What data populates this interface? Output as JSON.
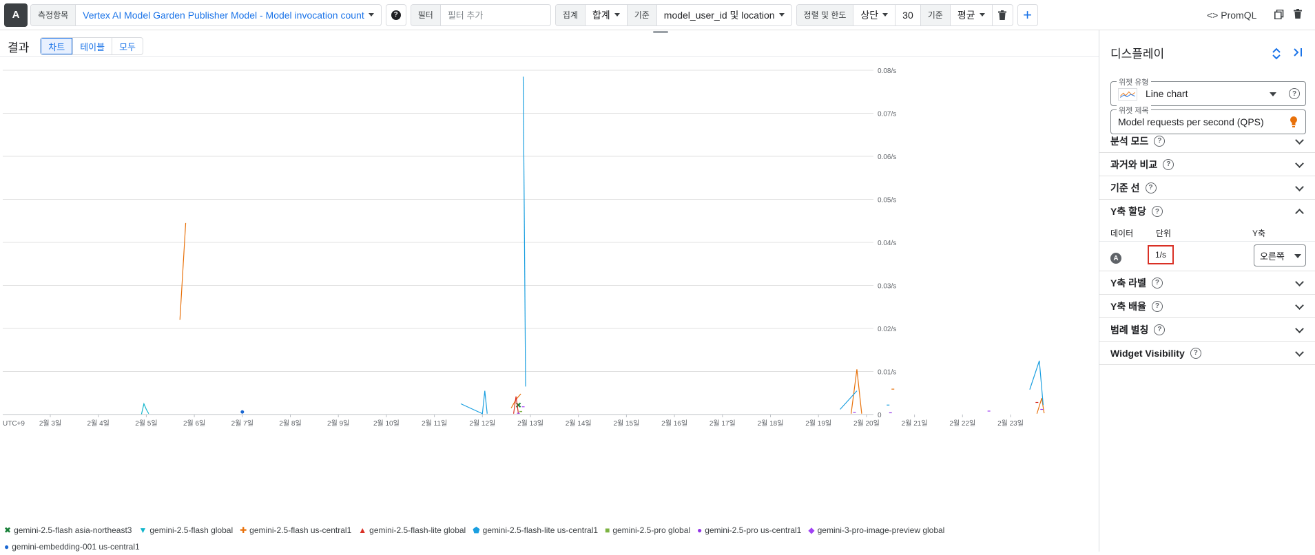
{
  "toolbar": {
    "badge": "A",
    "metric_label": "측정항목",
    "metric_value": "Vertex AI Model Garden Publisher Model - Model invocation count",
    "filter_label": "필터",
    "filter_placeholder": "필터 추가",
    "aggregate_label": "집계",
    "aggregate_value": "합계",
    "by_label": "기준",
    "by_value": "model_user_id 및 location",
    "sort_label": "정렬 및 한도",
    "sort_value": "상단",
    "limit_value": "30",
    "sort_by_label": "기준",
    "sort_by_value": "평균",
    "promql": "<> PromQL"
  },
  "results": {
    "title": "결과",
    "tabs": [
      "차트",
      "테이블",
      "모두"
    ],
    "active_tab": "차트"
  },
  "chart_data": {
    "type": "line",
    "title": "",
    "timezone_label": "UTC+9",
    "x_ticks": [
      "2월 3일",
      "2월 4일",
      "2월 5일",
      "2월 6일",
      "2월 7일",
      "2월 8일",
      "2월 9일",
      "2월 10일",
      "2월 11일",
      "2월 12일",
      "2월 13일",
      "2월 14일",
      "2월 15일",
      "2월 16일",
      "2월 17일",
      "2월 18일",
      "2월 19일",
      "2월 20일",
      "2월 21일",
      "2월 22일",
      "2월 23일"
    ],
    "y_ticks": [
      "0",
      "0.01/s",
      "0.02/s",
      "0.03/s",
      "0.04/s",
      "0.05/s",
      "0.06/s",
      "0.07/s",
      "0.08/s"
    ],
    "ylim": [
      0,
      0.08
    ],
    "xlim": [
      2.25,
      23.7
    ],
    "y_axis_side": "right",
    "grid": true,
    "series": [
      {
        "name": "gemini-2.5-flash asia-northeast3",
        "color": "#188038",
        "marker": "cross",
        "points": [
          [
            12.75,
            0.0022
          ]
        ]
      },
      {
        "name": "gemini-2.5-flash global",
        "color": "#12b5cb",
        "marker": "triangle-down",
        "points": [
          [
            4.9,
            0.0001
          ],
          [
            4.95,
            0.0025
          ],
          [
            5.0,
            0.0012
          ],
          [
            5.05,
            0.0002
          ]
        ]
      },
      {
        "name": "gemini-2.5-flash us-central1",
        "color": "#e8710a",
        "marker": "plus",
        "points": [
          [
            5.7,
            0.022
          ],
          [
            5.82,
            0.0445
          ],
          [
            12.6,
            0.0015
          ],
          [
            12.7,
            0.0035
          ],
          [
            12.8,
            0.0048
          ],
          [
            19.68,
            0.0002
          ],
          [
            19.8,
            0.0105
          ],
          [
            19.9,
            0.0002
          ],
          [
            20.55,
            0.0059
          ],
          [
            23.55,
            0.0002
          ],
          [
            23.65,
            0.0038
          ],
          [
            23.7,
            0.0003
          ]
        ]
      },
      {
        "name": "gemini-2.5-flash-lite global",
        "color": "#d93025",
        "marker": "triangle-up",
        "points": [
          [
            12.65,
            0.0002
          ],
          [
            12.7,
            0.0042
          ],
          [
            12.75,
            0.0002
          ],
          [
            23.55,
            0.0028
          ]
        ]
      },
      {
        "name": "gemini-2.5-flash-lite us-central1",
        "color": "#1a9fe0",
        "marker": "shield",
        "points": [
          [
            11.55,
            0.0025
          ],
          [
            12.0,
            0.0002
          ],
          [
            12.05,
            0.0055
          ],
          [
            12.1,
            0.0002
          ],
          [
            12.85,
            0.0785
          ],
          [
            12.9,
            0.0065
          ],
          [
            19.45,
            0.0012
          ],
          [
            19.8,
            0.0055
          ],
          [
            20.45,
            0.0022
          ],
          [
            23.4,
            0.0058
          ],
          [
            23.6,
            0.0125
          ],
          [
            23.68,
            0.0022
          ]
        ]
      },
      {
        "name": "gemini-2.5-pro global",
        "color": "#7cb342",
        "marker": "square",
        "points": [
          [
            12.8,
            0.0007
          ]
        ]
      },
      {
        "name": "gemini-2.5-pro us-central1",
        "color": "#9334e6",
        "marker": "circle",
        "points": [
          [
            12.75,
            0.0003
          ],
          [
            19.75,
            0.0005
          ],
          [
            20.5,
            0.0004
          ],
          [
            23.65,
            0.0012
          ]
        ]
      },
      {
        "name": "gemini-3-pro-image-preview global",
        "color": "#a142f4",
        "marker": "diamond",
        "points": [
          [
            12.85,
            0.0018
          ],
          [
            22.55,
            0.0008
          ]
        ]
      },
      {
        "name": "gemini-embedding-001 us-central1",
        "color": "#1967d2",
        "marker": "dot",
        "points": [
          [
            7.0,
            0.0006
          ]
        ]
      }
    ]
  },
  "panel": {
    "title": "디스플레이",
    "widget_type_label": "위젯 유형",
    "widget_type_value": "Line chart",
    "widget_title_label": "위젯 제목",
    "widget_title_value": "Model requests per second (QPS)",
    "sections": [
      {
        "label": "분석 모드",
        "expanded": false
      },
      {
        "label": "과거와 비교",
        "expanded": false
      },
      {
        "label": "기준 선",
        "expanded": false
      },
      {
        "label": "Y축 할당",
        "expanded": true
      },
      {
        "label": "Y축 라벨",
        "expanded": false
      },
      {
        "label": "Y축 배율",
        "expanded": false
      },
      {
        "label": "범례 별칭",
        "expanded": false
      },
      {
        "label": "Widget Visibility",
        "expanded": false
      }
    ],
    "yaxis_assign": {
      "col_data": "데이터",
      "col_unit": "단위",
      "col_axis": "Y축",
      "row_badge": "A",
      "unit": "1/s",
      "axis_value": "오른쪽"
    }
  }
}
